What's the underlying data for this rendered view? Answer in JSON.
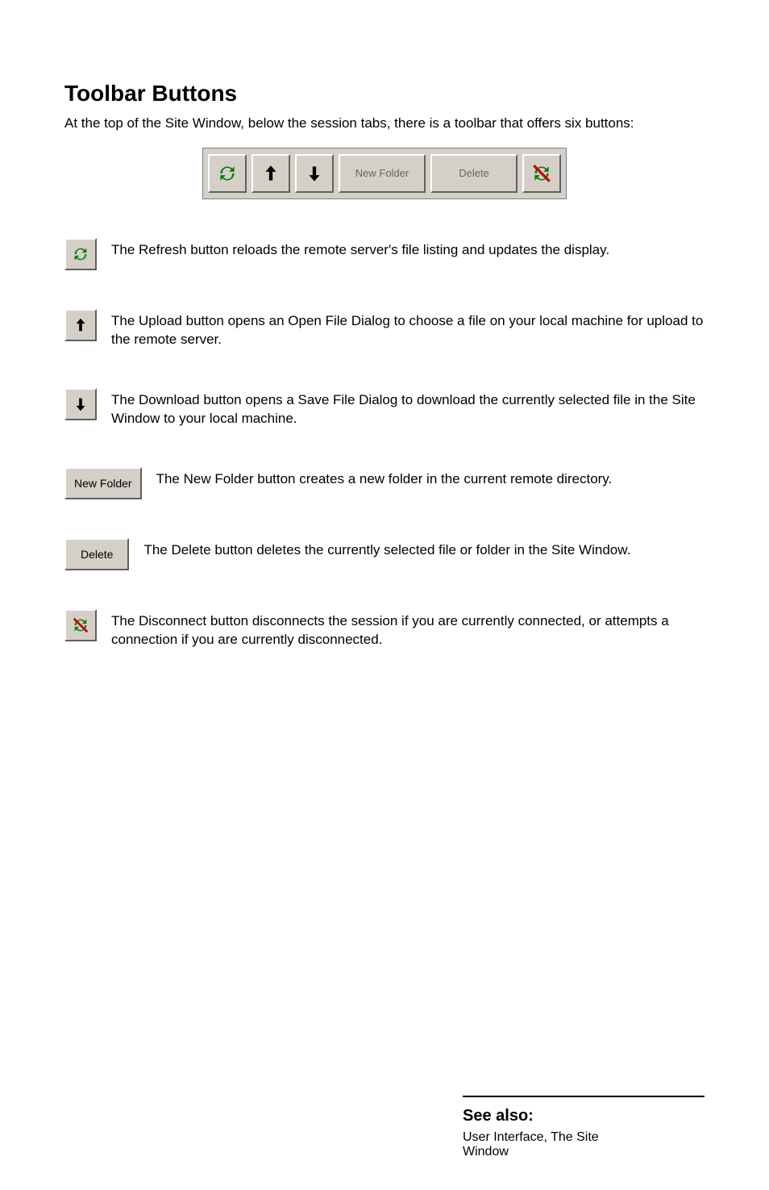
{
  "heading": "Toolbar Buttons",
  "intro": "At the top of the Site Window, below the session tabs, there is a toolbar that offers six buttons:",
  "toolbar": {
    "new_folder_label": "New Folder",
    "delete_label": "Delete"
  },
  "items": [
    {
      "label": "Refresh",
      "desc": "The Refresh button reloads the remote server's file listing and updates the display."
    },
    {
      "label": "Upload",
      "desc": "The Upload  button opens an Open File Dialog to choose a file on your local machine for upload to the remote server."
    },
    {
      "label": "Download",
      "desc": "The Download button opens a Save File Dialog to download the currently selected file in the Site Window to your local machine."
    },
    {
      "label": "New Folder",
      "desc": "The New Folder button creates a new folder in the current remote directory."
    },
    {
      "label": "Delete",
      "desc": "The Delete button deletes the currently selected file or folder in the Site Window."
    },
    {
      "label": "Disconnect",
      "desc": "The Disconnect button disconnects the session if you are currently connected, or attempts a connection if you are currently disconnected."
    }
  ],
  "see_also": {
    "title": "See also:",
    "line1": "User Interface, The   Site",
    "line2": "Window"
  }
}
